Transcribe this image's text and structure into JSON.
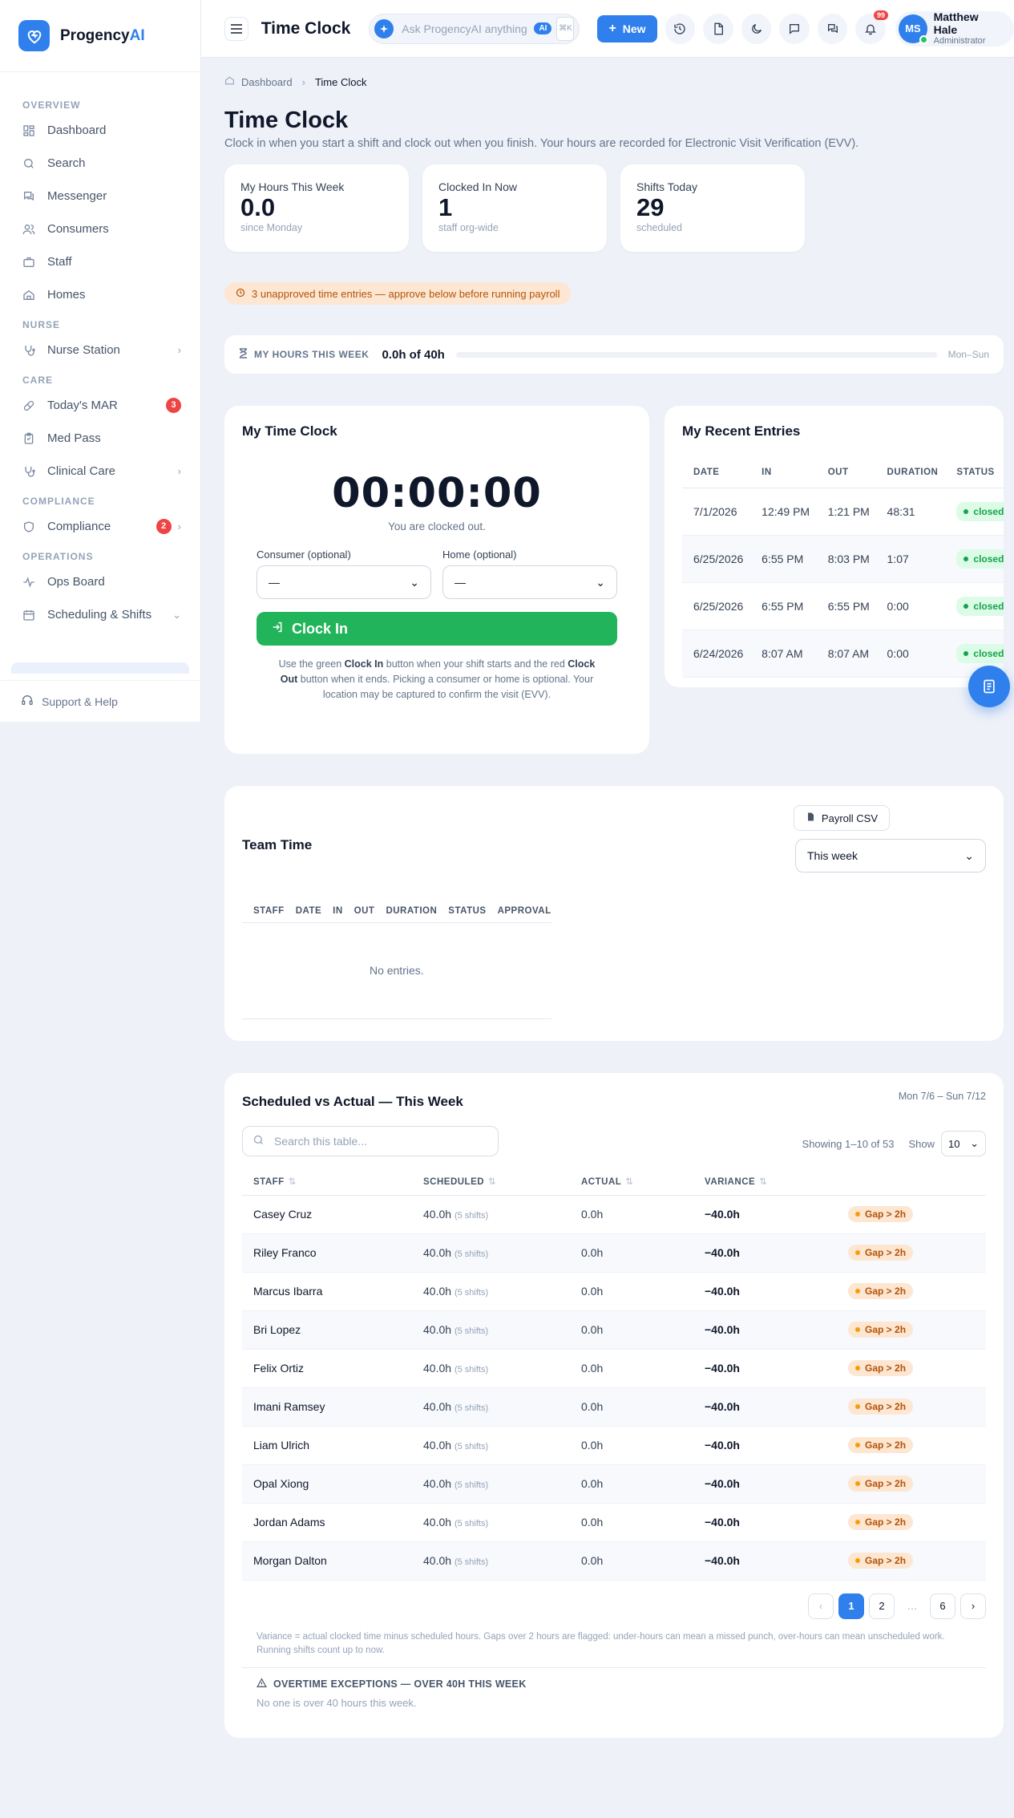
{
  "brand": {
    "name_prefix": "Progency",
    "name_suffix": "AI"
  },
  "sidebar": {
    "sections": {
      "overview": "OVERVIEW",
      "nurse": "NURSE",
      "care": "CARE",
      "compliance": "COMPLIANCE",
      "operations": "OPERATIONS"
    },
    "items": {
      "dashboard": "Dashboard",
      "search": "Search",
      "messenger": "Messenger",
      "consumers": "Consumers",
      "staff": "Staff",
      "homes": "Homes",
      "nurse_station": "Nurse Station",
      "todays_mar": "Today's MAR",
      "todays_mar_badge": "3",
      "med_pass": "Med Pass",
      "clinical_care": "Clinical Care",
      "compliance": "Compliance",
      "compliance_badge": "2",
      "ops_board": "Ops Board",
      "scheduling": "Scheduling & Shifts"
    },
    "support": "Support & Help"
  },
  "header": {
    "title": "Time Clock",
    "ask_placeholder": "Ask ProgencyAI anything",
    "ask_badge": "AI",
    "kbd_cmd": "⌘",
    "kbd_key": "K",
    "new_label": "New",
    "notif_count": "99",
    "user": {
      "initials": "MS",
      "name": "Matthew Hale",
      "role": "Administrator"
    }
  },
  "breadcrumb": {
    "home": "Dashboard",
    "current": "Time Clock"
  },
  "page": {
    "title": "Time Clock",
    "subtitle": "Clock in when you start a shift and clock out when you finish. Your hours are recorded for Electronic Visit Verification (EVV)."
  },
  "stats": [
    {
      "label": "My Hours This Week",
      "value": "0.0",
      "sub": "since Monday"
    },
    {
      "label": "Clocked In Now",
      "value": "1",
      "sub": "staff org-wide"
    },
    {
      "label": "Shifts Today",
      "value": "29",
      "sub": "scheduled"
    }
  ],
  "alert": "3 unapproved time entries — approve below before running payroll",
  "hours_bar": {
    "label": "MY HOURS THIS WEEK",
    "value": "0.0h of 40h",
    "progress_fraction": 0.0,
    "range": "Mon–Sun"
  },
  "clock": {
    "title": "My Time Clock",
    "time": "00:00:00",
    "status": "You are clocked out.",
    "consumer_label": "Consumer (optional)",
    "consumer_value": "—",
    "home_label": "Home (optional)",
    "home_value": "—",
    "button": "Clock In",
    "help_pre": "Use the green ",
    "help_b1": "Clock In",
    "help_mid": " button when your shift starts and the red ",
    "help_b2": "Clock Out",
    "help_post": " button when it ends. Picking a consumer or home is optional. Your location may be captured to confirm the visit (EVV)."
  },
  "recent": {
    "title": "My Recent Entries",
    "columns": [
      "DATE",
      "IN",
      "OUT",
      "DURATION",
      "STATUS"
    ],
    "rows": [
      {
        "date": "7/1/2026",
        "in": "12:49 PM",
        "out": "1:21 PM",
        "duration": "48:31",
        "status": "closed"
      },
      {
        "date": "6/25/2026",
        "in": "6:55 PM",
        "out": "8:03 PM",
        "duration": "1:07",
        "status": "closed"
      },
      {
        "date": "6/25/2026",
        "in": "6:55 PM",
        "out": "6:55 PM",
        "duration": "0:00",
        "status": "closed"
      },
      {
        "date": "6/24/2026",
        "in": "8:07 AM",
        "out": "8:07 AM",
        "duration": "0:00",
        "status": "closed"
      }
    ]
  },
  "team": {
    "title": "Team Time",
    "csv_label": "Payroll CSV",
    "period": "This week",
    "columns": [
      "STAFF",
      "DATE",
      "IN",
      "OUT",
      "DURATION",
      "STATUS",
      "APPROVAL"
    ],
    "empty": "No entries."
  },
  "sva": {
    "title": "Scheduled vs Actual — This Week",
    "range": "Mon 7/6 – Sun 7/12",
    "search_placeholder": "Search this table...",
    "showing": "Showing 1–10 of 53",
    "show_label": "Show",
    "show_value": "10",
    "columns": [
      "STAFF",
      "SCHEDULED",
      "ACTUAL",
      "VARIANCE"
    ],
    "shifts_text": "(5 shifts)",
    "rows": [
      {
        "staff": "Casey Cruz",
        "scheduled": "40.0h",
        "actual": "0.0h",
        "variance": "−40.0h",
        "flag": "Gap > 2h"
      },
      {
        "staff": "Riley Franco",
        "scheduled": "40.0h",
        "actual": "0.0h",
        "variance": "−40.0h",
        "flag": "Gap > 2h"
      },
      {
        "staff": "Marcus Ibarra",
        "scheduled": "40.0h",
        "actual": "0.0h",
        "variance": "−40.0h",
        "flag": "Gap > 2h"
      },
      {
        "staff": "Bri Lopez",
        "scheduled": "40.0h",
        "actual": "0.0h",
        "variance": "−40.0h",
        "flag": "Gap > 2h"
      },
      {
        "staff": "Felix Ortiz",
        "scheduled": "40.0h",
        "actual": "0.0h",
        "variance": "−40.0h",
        "flag": "Gap > 2h"
      },
      {
        "staff": "Imani Ramsey",
        "scheduled": "40.0h",
        "actual": "0.0h",
        "variance": "−40.0h",
        "flag": "Gap > 2h"
      },
      {
        "staff": "Liam Ulrich",
        "scheduled": "40.0h",
        "actual": "0.0h",
        "variance": "−40.0h",
        "flag": "Gap > 2h"
      },
      {
        "staff": "Opal Xiong",
        "scheduled": "40.0h",
        "actual": "0.0h",
        "variance": "−40.0h",
        "flag": "Gap > 2h"
      },
      {
        "staff": "Jordan Adams",
        "scheduled": "40.0h",
        "actual": "0.0h",
        "variance": "−40.0h",
        "flag": "Gap > 2h"
      },
      {
        "staff": "Morgan Dalton",
        "scheduled": "40.0h",
        "actual": "0.0h",
        "variance": "−40.0h",
        "flag": "Gap > 2h"
      }
    ],
    "pages": {
      "p1": "1",
      "p2": "2",
      "ellipsis": "…",
      "last": "6"
    },
    "note": "Variance = actual clocked time minus scheduled hours. Gaps over 2 hours are flagged: under-hours can mean a missed punch, over-hours can mean unscheduled work. Running shifts count up to now.",
    "ot_title": "OVERTIME EXCEPTIONS — OVER 40H THIS WEEK",
    "ot_text": "No one is over 40 hours this week."
  },
  "colors": {
    "accent": "#2f80ed",
    "success": "#21b45a",
    "danger": "#ef4444",
    "warning_bg": "#fde7d2",
    "warning_text": "#b45309"
  }
}
